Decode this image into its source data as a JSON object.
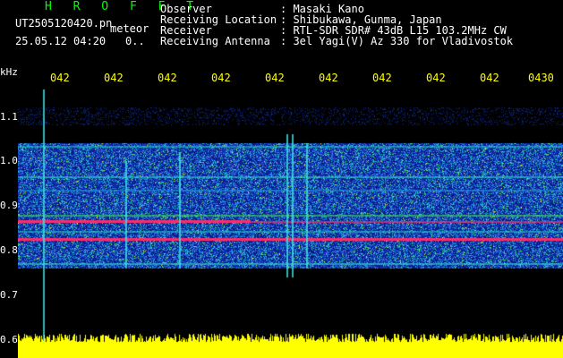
{
  "header": {
    "title": "H R O F F T",
    "file_name": "UT2505120420.pn",
    "mode": "meteor",
    "datetime": "25.05.12 04:20",
    "counter": "0..",
    "fields": [
      {
        "label": "Observer",
        "value": ": Masaki Kano"
      },
      {
        "label": "Receiving Location",
        "value": ": Shibukawa, Gunma, Japan"
      },
      {
        "label": "Receiver",
        "value": ": RTL-SDR SDR# 43dB L15 103.2MHz CW"
      },
      {
        "label": "Receiving Antenna",
        "value": ": 3el Yagi(V) Az 330 for Vladivostok"
      }
    ]
  },
  "time_ticks": [
    "042",
    "042",
    "042",
    "042",
    "042",
    "042",
    "042",
    "042",
    "042",
    "0430"
  ],
  "y_axis": {
    "unit": "kHz",
    "labels": [
      "1.1",
      "1.0",
      "0.9",
      "0.8",
      "0.7",
      "0.6"
    ]
  },
  "colors": {
    "background": "#000000",
    "header_title": "#00ff00",
    "tick_text": "#ffff00",
    "noise_floor": "#ffff00",
    "carrier": "#ff2a6a"
  }
}
